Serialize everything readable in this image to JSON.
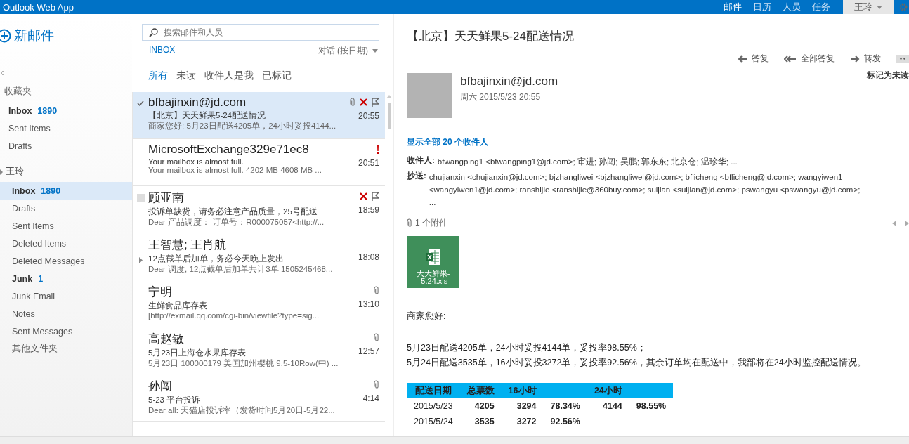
{
  "header": {
    "app_title": "Outlook Web App",
    "nav": [
      {
        "label": "邮件",
        "selected": true
      },
      {
        "label": "日历",
        "selected": false
      },
      {
        "label": "人员",
        "selected": false
      },
      {
        "label": "任务",
        "selected": false
      }
    ],
    "user": "王玲"
  },
  "sidebar": {
    "new_mail": "新邮件",
    "favorites_label": "收藏夹",
    "favorites": [
      {
        "label": "Inbox",
        "count": "1890",
        "bold": true,
        "selected": false
      },
      {
        "label": "Sent Items",
        "bold": false,
        "selected": false
      },
      {
        "label": "Drafts",
        "bold": false,
        "selected": false
      }
    ],
    "account": "王玲",
    "folders": [
      {
        "label": "Inbox",
        "count": "1890",
        "bold": true,
        "selected": true
      },
      {
        "label": "Drafts",
        "bold": false,
        "selected": false
      },
      {
        "label": "Sent Items",
        "bold": false,
        "selected": false
      },
      {
        "label": "Deleted Items",
        "bold": false,
        "selected": false
      },
      {
        "label": "Deleted Messages",
        "bold": false,
        "selected": false
      },
      {
        "label": "Junk",
        "count": "1",
        "bold": true,
        "selected": false
      },
      {
        "label": "Junk Email",
        "bold": false,
        "selected": false
      },
      {
        "label": "Notes",
        "bold": false,
        "selected": false
      },
      {
        "label": "Sent Messages",
        "bold": false,
        "selected": false
      },
      {
        "label": "其他文件夹",
        "bold": false,
        "selected": false
      }
    ]
  },
  "list": {
    "search_placeholder": "搜索邮件和人员",
    "folder": "INBOX",
    "sort": "对话 (按日期)",
    "filters": [
      {
        "label": "所有",
        "selected": true
      },
      {
        "label": "未读",
        "selected": false
      },
      {
        "label": "收件人是我",
        "selected": false
      },
      {
        "label": "已标记",
        "selected": false
      }
    ],
    "messages": [
      {
        "sender": "bfbajinxin@jd.com",
        "subject": "【北京】天天鲜果5-24配送情况",
        "preview": "商家您好: 5月23日配送4205单，24小时妥投4144...",
        "time": "20:55",
        "selected": true,
        "attachment": true,
        "flag": true,
        "important": false,
        "expandable": false
      },
      {
        "sender": "MicrosoftExchange329e71ec8",
        "subject": "Your mailbox is almost full.",
        "preview": "Your mailbox is almost full.  4202 MB 4608 MB ...",
        "time": "20:51",
        "selected": false,
        "attachment": false,
        "flag": false,
        "important": true,
        "expandable": false
      },
      {
        "sender": "顾亚南",
        "subject": "投诉单缺货，请务必注意产品质量，25号配送",
        "preview": "Dear 产品调度：  订单号：R000075057<http://...",
        "time": "18:59",
        "selected": false,
        "attachment": false,
        "flag": true,
        "important": false,
        "expandable": false
      },
      {
        "sender": "王智慧; 王肖航",
        "subject": "12点截单后加单，务必今天晚上发出",
        "preview": "Dear 调度, 12点截单后加单共计3单  1505245468...",
        "time": "18:08",
        "selected": false,
        "attachment": false,
        "flag": false,
        "important": false,
        "expandable": true
      },
      {
        "sender": "宁明",
        "subject": "生鲜食品库存表",
        "preview": "[http://exmail.qq.com/cgi-bin/viewfile?type=sig...",
        "time": "13:10",
        "selected": false,
        "attachment": true,
        "flag": false,
        "important": false,
        "expandable": false
      },
      {
        "sender": "高赵敏",
        "subject": "5月23日上海仓水果库存表",
        "preview": "5月23日 100000179 美国加州樱桃 9.5-10Row(中) ...",
        "time": "12:57",
        "selected": false,
        "attachment": true,
        "flag": false,
        "important": false,
        "expandable": false
      },
      {
        "sender": "孙闯",
        "subject": "5-23 平台投诉",
        "preview": "Dear all: 天猫店投诉率（发货时间5月20日-5月22...",
        "time": "4:14",
        "selected": false,
        "attachment": true,
        "flag": false,
        "important": false,
        "expandable": false
      }
    ]
  },
  "reading": {
    "subject": "【北京】天天鲜果5-24配送情况",
    "actions": [
      {
        "label": "答复",
        "kind": "reply"
      },
      {
        "label": "全部答复",
        "kind": "replyall"
      },
      {
        "label": "转发",
        "kind": "forward"
      }
    ],
    "mark_unread": "标记为未读",
    "sender": "bfbajinxin@jd.com",
    "date": "周六 2015/5/23 20:55",
    "show_all": "显示全部 **20** 个收件人",
    "to_label": "收件人:",
    "to": "bfwangping1 <bfwangping1@jd.com>; 审进; 孙闯; 吴鹏; 郭东东; 北京仓; 温珍华; ...",
    "cc_label": "抄送:",
    "cc": "chujianxin <chujianxin@jd.com>;  bjzhangliwei <bjzhangliwei@jd.com>;  bflicheng <bflicheng@jd.com>;  wangyiwen1 <wangyiwen1@jd.com>;  ranshijie <ranshijie@360buy.com>;  suijian <suijian@jd.com>;  pswangyu <pswangyu@jd.com>;  ...",
    "attachments_label": "1 个附件",
    "attachment": {
      "name_line1": "大大鲜果-",
      "name_line2": "-5.24.xls"
    },
    "greeting": "商家您好:",
    "lines": [
      "5月23日配送4205单，24小时妥投4144单，妥投率98.55%；",
      "5月24日配送3535单，16小时妥投3272单，妥投率92.56%，其余订单均在配送中，我部将在24小时监控配送情况。"
    ],
    "table": {
      "columns": [
        "配送日期",
        "总票数",
        "16小时",
        null,
        "24小时",
        null
      ],
      "rows": [
        [
          "2015/5/23",
          "4205",
          "3294",
          "78.34%",
          "4144",
          "98.55%"
        ],
        [
          "2015/5/24",
          "3535",
          "3272",
          "92.56%"
        ]
      ]
    }
  }
}
